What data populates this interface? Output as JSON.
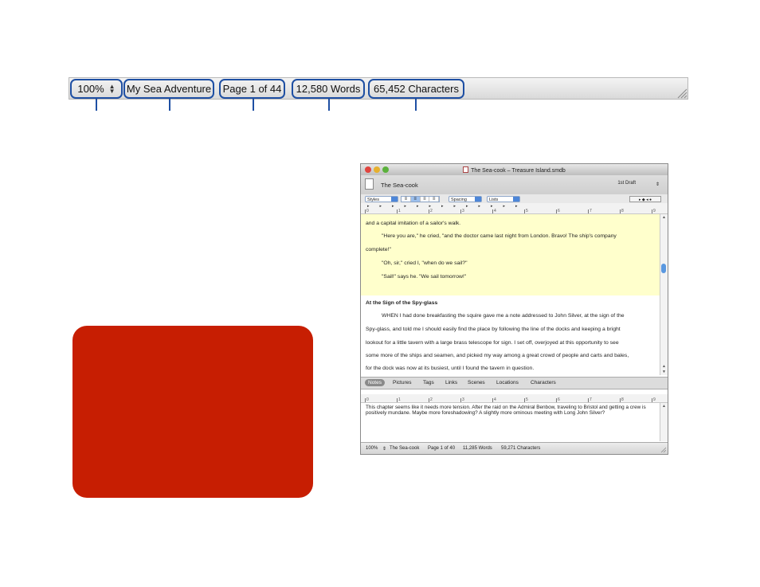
{
  "status_bar": {
    "zoom": "100%",
    "document_title": "My Sea Adventure",
    "page": "Page 1 of 44",
    "words": "12,580 Words",
    "characters": "65,452 Characters"
  },
  "colors": {
    "callout_blue": "#1e4fa3",
    "red_box": "#c71e02",
    "highlight": "#ffffcc",
    "selection_blue": "#5a98e0"
  },
  "window": {
    "title": "The Sea-cook – Treasure Island.smdb",
    "chapter_title": "The Sea-cook",
    "draft_label": "1st Draft",
    "toolbar": {
      "styles": "Styles",
      "spacing": "Spacing",
      "lists": "Lists"
    },
    "ruler_numbers": [
      "0",
      "1",
      "2",
      "3",
      "4",
      "5",
      "6",
      "7",
      "8",
      "9"
    ],
    "editor": {
      "line1": "and a capital imitation of a sailor's walk.",
      "line2": "\"Here you are,\" he cried, \"and the doctor came last night from London. Bravo! The ship's company",
      "line3": "complete!\"",
      "line4": "\"Oh, sir,\" cried I, \"when do we sail?\"",
      "line5": "\"Sail!\" says he. \"We sail tomorrow!\"",
      "heading": "At the Sign of the Spy-glass",
      "line6": "WHEN I had done breakfasting the squire gave me a note addressed to John Silver, at the sign of the",
      "line7": "Spy-glass, and told me I should easily find the place by following the line of the docks and keeping a bright",
      "line8": "lookout for a little tavern with a large brass telescope for sign. I set off, overjoyed at this opportunity to see",
      "line9": "some more of the ships and seamen, and picked my way among a great crowd of people and carts and bales,",
      "line10": "for the dock was now at its busiest, until I found the tavern in question."
    },
    "notes_tabs": [
      "Notes",
      "Pictures",
      "Tags",
      "Links",
      "Scenes",
      "Locations",
      "Characters"
    ],
    "notes_text": "This chapter seems like it needs more tension.  After the raid on the Admiral Benbow, traveling to Bristol and getting a crew is positively mundane.  Maybe more foreshadowing?  A slightly more ominous meeting with Long John Silver?",
    "status": {
      "zoom": "100%",
      "title": "The Sea-cook",
      "page": "Page 1 of 40",
      "words": "11,285 Words",
      "characters": "59,271 Characters"
    }
  }
}
